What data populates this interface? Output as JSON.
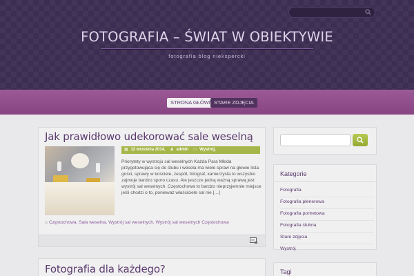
{
  "header": {
    "site_title": "Fotografia – świat w obiektywie",
    "tagline": "fotografia blog niekspercki",
    "search_placeholder": ""
  },
  "nav": {
    "items": [
      {
        "label": "Strona główna",
        "active": true
      },
      {
        "label": "Stare zdjęcia",
        "active": false
      }
    ]
  },
  "posts": [
    {
      "title": "Jak prawidłowo udekorować sale weselną",
      "date": "12 września 2014,",
      "author": "admin",
      "category": "Wystrój,",
      "excerpt": "Priorytety w wystroju sal weselnych Każda Para Młoda przygotowująca się do ślubu i wesela ma wiele spraw na głowie lista gości, sprawy w kościele, zespół, fotograf, kamerzysta to wszystko zajmuje bardzo sporo czasu.  Ale jeszcze jedną ważną sprawą jest wystrój sal weselnych. Częstochowa to bardzo nieprzyjemnie miejsce jeśli chodzi o to, ponieważ właściciele sal nie […]",
      "tags": "Częstochowa, Sala weselna, Wystrój sal weselnych, Wystrój sal weselnych Częstochowa"
    },
    {
      "title": "Fotografia dla każdego?"
    }
  ],
  "sidebar": {
    "search_value": "",
    "categories_title": "Kategorie",
    "categories": [
      "Fotografia",
      "Fotografia plenerowa",
      "Fotografia portretowa",
      "Fotografia ślubna",
      "Stare zdjęcia",
      "Wystrój"
    ],
    "tags_title": "Tagi"
  },
  "colors": {
    "header_bg": "#3c2d52",
    "nav_bg": "#874683",
    "accent_green": "#a6b64a",
    "link_purple": "#5b3a6d"
  }
}
